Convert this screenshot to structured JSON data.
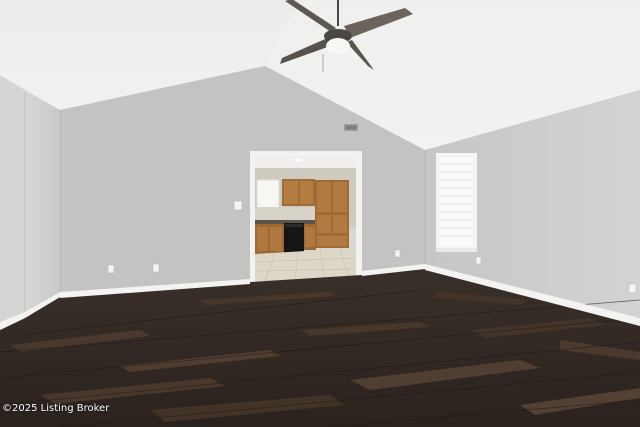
{
  "watermark": {
    "text": "©2025 Listing Broker"
  },
  "colors": {
    "ceiling": "#efefee",
    "wall_left": "#c6c6c4",
    "wall_back": "#c4c4c2",
    "wall_right": "#cdcdcb",
    "baseboard": "#f4f4f2",
    "floor_dark": "#2f2824",
    "floor_mid": "#4a3b31",
    "cabinet": "#a7733c",
    "kitchen_floor": "#ddd6c6"
  },
  "icons": [
    "ceiling-fan-icon",
    "light-fixture-icon",
    "electrical-outlet-icon",
    "light-switch-icon",
    "air-vent-icon"
  ]
}
